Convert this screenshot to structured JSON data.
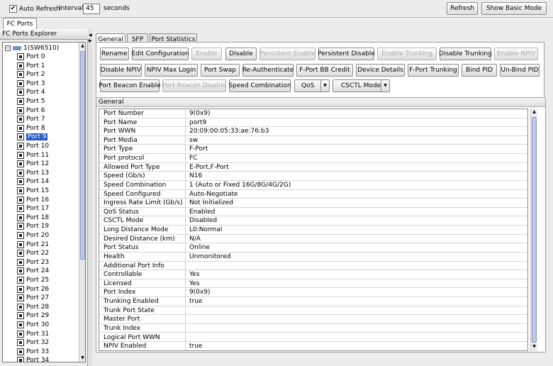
{
  "toolbar": {
    "auto_refresh_label": "Auto Refresh",
    "auto_refresh_checked": "✔",
    "interval_label": "Interval",
    "interval_value": "45",
    "seconds_label": "seconds",
    "refresh_label": "Refresh",
    "basic_mode_label": "Show Basic Mode"
  },
  "top_tab": "FC Ports",
  "explorer": {
    "title": "FC Ports Explorer",
    "switch_node": "1(SW6510)",
    "ports": [
      "Port 0",
      "Port 1",
      "Port 2",
      "Port 3",
      "Port 4",
      "Port 5",
      "Port 6",
      "Port 7",
      "Port 8",
      "Port 9",
      "Port 10",
      "Port 11",
      "Port 12",
      "Port 13",
      "Port 14",
      "Port 15",
      "Port 16",
      "Port 17",
      "Port 18",
      "Port 19",
      "Port 20",
      "Port 21",
      "Port 22",
      "Port 23",
      "Port 24",
      "Port 25",
      "Port 26",
      "Port 27",
      "Port 28",
      "Port 29",
      "Port 30",
      "Port 31",
      "Port 32",
      "Port 33",
      "Port 34"
    ],
    "selected": "Port 9"
  },
  "tabs": [
    "General",
    "SFP",
    "Port Statistics"
  ],
  "active_tab": "General",
  "buttons": {
    "row1": [
      {
        "label": "Rename",
        "enabled": true
      },
      {
        "label": "Edit Configuration",
        "enabled": true
      },
      {
        "label": "Enable",
        "enabled": false
      },
      {
        "label": "Disable",
        "enabled": true
      },
      {
        "label": "Persistent Enable",
        "enabled": false
      },
      {
        "label": "Persistent Disable",
        "enabled": true
      },
      {
        "label": "Enable Trunking",
        "enabled": false
      },
      {
        "label": "Disable Trunking",
        "enabled": true
      },
      {
        "label": "Enable NPIV",
        "enabled": false
      }
    ],
    "row2": [
      {
        "label": "Disable NPIV",
        "enabled": true
      },
      {
        "label": "NPIV Max Login",
        "enabled": true
      },
      {
        "label": "Port Swap",
        "enabled": true
      },
      {
        "label": "Re-Authenticate",
        "enabled": true
      },
      {
        "label": "F-Port BB Credit",
        "enabled": true
      },
      {
        "label": "Device Details",
        "enabled": true
      },
      {
        "label": "F-Port Trunking",
        "enabled": true
      },
      {
        "label": "Bind PID",
        "enabled": true
      },
      {
        "label": "Un-Bind PID",
        "enabled": true
      }
    ],
    "row3": [
      {
        "label": "Port Beacon Enable",
        "enabled": true
      },
      {
        "label": "Port Beacon Disable",
        "enabled": false
      },
      {
        "label": "Speed Combination",
        "enabled": true
      }
    ],
    "qos_label": "QoS",
    "csctl_label": "CSCTL Mode"
  },
  "general_panel": {
    "title": "General",
    "rows": [
      {
        "key": "Port Number",
        "value": "9(0x9)"
      },
      {
        "key": "Port Name",
        "value": "port9"
      },
      {
        "key": "Port WWN",
        "value": "20:09:00:05:33:ae:76:b3"
      },
      {
        "key": "Port Media",
        "value": "sw"
      },
      {
        "key": "Port Type",
        "value": "F-Port"
      },
      {
        "key": "Port protocol",
        "value": "FC"
      },
      {
        "key": "Allowed Port Type",
        "value": "E-Port,F-Port"
      },
      {
        "key": "Speed (Gb/s)",
        "value": "N16"
      },
      {
        "key": "Speed Combination",
        "value": "1 (Auto or Fixed 16G/8G/4G/2G)"
      },
      {
        "key": "Speed Configured",
        "value": "Auto-Negotiate"
      },
      {
        "key": "Ingress Rate Limit (Gb/s)",
        "value": "Not Initialized"
      },
      {
        "key": "QoS Status",
        "value": "Enabled"
      },
      {
        "key": "CSCTL Mode",
        "value": "Disabled"
      },
      {
        "key": "Long Distance Mode",
        "value": "L0:Normal"
      },
      {
        "key": "Desired Distance (km)",
        "value": "N/A"
      },
      {
        "key": "Port Status",
        "value": "Online"
      },
      {
        "key": "Health",
        "value": "Unmonitored"
      },
      {
        "key": "Additional Port Info",
        "value": ""
      },
      {
        "key": "Controllable",
        "value": "Yes"
      },
      {
        "key": "Licensed",
        "value": "Yes"
      },
      {
        "key": "Port Index",
        "value": "9(0x9)"
      },
      {
        "key": "Trunking Enabled",
        "value": "true"
      },
      {
        "key": "Trunk Port State",
        "value": ""
      },
      {
        "key": "Master Port",
        "value": ""
      },
      {
        "key": "Trunk Index",
        "value": ""
      },
      {
        "key": "Logical Port WWN",
        "value": ""
      },
      {
        "key": "NPIV Enabled",
        "value": "true"
      }
    ]
  }
}
